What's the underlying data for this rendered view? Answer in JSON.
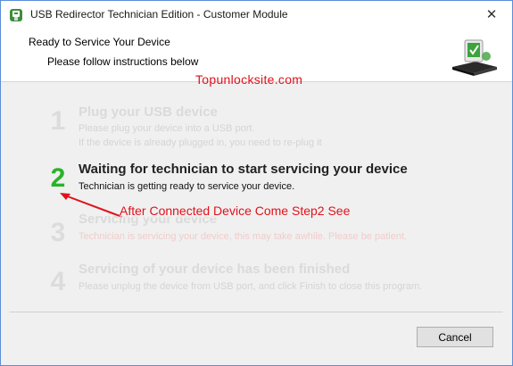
{
  "window": {
    "title": "USB Redirector Technician Edition - Customer Module",
    "close_glyph": "✕"
  },
  "header": {
    "title": "Ready to Service Your Device",
    "subtitle": "Please follow instructions below",
    "logo_icon": "usb-device-logo-icon"
  },
  "watermark": "Topunlocksite.com",
  "steps": [
    {
      "number": "1",
      "title": "Plug your USB device",
      "desc_lines": [
        "Please plug your device into a USB port.",
        "If the device is already plugged in, you need to re-plug it"
      ],
      "active": false
    },
    {
      "number": "2",
      "title": "Waiting for technician to start servicing your device",
      "desc_lines": [
        "Technician is getting ready to service your device."
      ],
      "active": true
    },
    {
      "number": "3",
      "title": "Servicing your device",
      "desc_lines": [
        "Technician is servicing your device, this may take awhile. Please be patient."
      ],
      "active": false
    },
    {
      "number": "4",
      "title": "Servicing of your device has been finished",
      "desc_lines": [
        "Please unplug the device from USB port, and click Finish to close this program."
      ],
      "active": false
    }
  ],
  "annotation": "After Connected Device Come Step2 See",
  "footer": {
    "cancel_label": "Cancel"
  },
  "colors": {
    "active_number": "#28b42a",
    "inactive": "#dcdcdc",
    "annotation_red": "#e0121b"
  }
}
